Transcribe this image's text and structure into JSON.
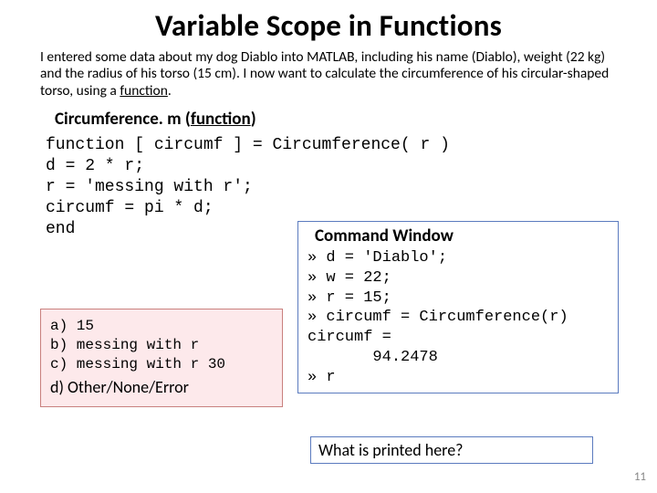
{
  "title": "Variable Scope in Functions",
  "desc_pre": "I entered some data about my dog Diablo into MATLAB, including his name (Diablo), weight (22 kg) and the radius of his torso (15 cm). I now want to calculate the circumference of his circular-shaped torso, using a ",
  "desc_link": "function",
  "desc_post": ".",
  "func_label_pre": "Circumference. m (",
  "func_label_link": "function",
  "func_label_post": ")",
  "code": "function [ circumf ] = Circumference( r )\nd = 2 * r;\nr = 'messing with r';\ncircumf = pi * d;\nend",
  "options": {
    "a": "a) 15",
    "b": "b) messing with r",
    "c": "c) messing with r   30",
    "d": "d)  Other/None/Error"
  },
  "cmd": {
    "title": "Command Window",
    "body": "» d = 'Diablo';\n» w = 22;\n» r = 15;\n» circumf = Circumference(r)\ncircumf =\n       94.2478\n» r"
  },
  "what": "What is printed here?",
  "page": "11"
}
